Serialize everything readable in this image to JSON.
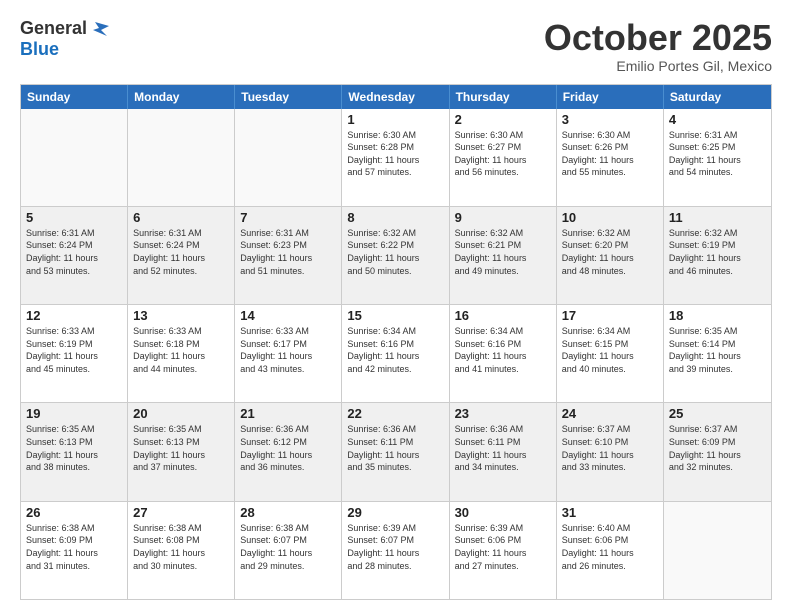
{
  "header": {
    "logo_general": "General",
    "logo_blue": "Blue",
    "month_title": "October 2025",
    "subtitle": "Emilio Portes Gil, Mexico"
  },
  "weekdays": [
    "Sunday",
    "Monday",
    "Tuesday",
    "Wednesday",
    "Thursday",
    "Friday",
    "Saturday"
  ],
  "weeks": [
    [
      {
        "day": "",
        "info": "",
        "empty": true
      },
      {
        "day": "",
        "info": "",
        "empty": true
      },
      {
        "day": "",
        "info": "",
        "empty": true
      },
      {
        "day": "1",
        "info": "Sunrise: 6:30 AM\nSunset: 6:28 PM\nDaylight: 11 hours\nand 57 minutes."
      },
      {
        "day": "2",
        "info": "Sunrise: 6:30 AM\nSunset: 6:27 PM\nDaylight: 11 hours\nand 56 minutes."
      },
      {
        "day": "3",
        "info": "Sunrise: 6:30 AM\nSunset: 6:26 PM\nDaylight: 11 hours\nand 55 minutes."
      },
      {
        "day": "4",
        "info": "Sunrise: 6:31 AM\nSunset: 6:25 PM\nDaylight: 11 hours\nand 54 minutes."
      }
    ],
    [
      {
        "day": "5",
        "info": "Sunrise: 6:31 AM\nSunset: 6:24 PM\nDaylight: 11 hours\nand 53 minutes."
      },
      {
        "day": "6",
        "info": "Sunrise: 6:31 AM\nSunset: 6:24 PM\nDaylight: 11 hours\nand 52 minutes."
      },
      {
        "day": "7",
        "info": "Sunrise: 6:31 AM\nSunset: 6:23 PM\nDaylight: 11 hours\nand 51 minutes."
      },
      {
        "day": "8",
        "info": "Sunrise: 6:32 AM\nSunset: 6:22 PM\nDaylight: 11 hours\nand 50 minutes."
      },
      {
        "day": "9",
        "info": "Sunrise: 6:32 AM\nSunset: 6:21 PM\nDaylight: 11 hours\nand 49 minutes."
      },
      {
        "day": "10",
        "info": "Sunrise: 6:32 AM\nSunset: 6:20 PM\nDaylight: 11 hours\nand 48 minutes."
      },
      {
        "day": "11",
        "info": "Sunrise: 6:32 AM\nSunset: 6:19 PM\nDaylight: 11 hours\nand 46 minutes."
      }
    ],
    [
      {
        "day": "12",
        "info": "Sunrise: 6:33 AM\nSunset: 6:19 PM\nDaylight: 11 hours\nand 45 minutes."
      },
      {
        "day": "13",
        "info": "Sunrise: 6:33 AM\nSunset: 6:18 PM\nDaylight: 11 hours\nand 44 minutes."
      },
      {
        "day": "14",
        "info": "Sunrise: 6:33 AM\nSunset: 6:17 PM\nDaylight: 11 hours\nand 43 minutes."
      },
      {
        "day": "15",
        "info": "Sunrise: 6:34 AM\nSunset: 6:16 PM\nDaylight: 11 hours\nand 42 minutes."
      },
      {
        "day": "16",
        "info": "Sunrise: 6:34 AM\nSunset: 6:16 PM\nDaylight: 11 hours\nand 41 minutes."
      },
      {
        "day": "17",
        "info": "Sunrise: 6:34 AM\nSunset: 6:15 PM\nDaylight: 11 hours\nand 40 minutes."
      },
      {
        "day": "18",
        "info": "Sunrise: 6:35 AM\nSunset: 6:14 PM\nDaylight: 11 hours\nand 39 minutes."
      }
    ],
    [
      {
        "day": "19",
        "info": "Sunrise: 6:35 AM\nSunset: 6:13 PM\nDaylight: 11 hours\nand 38 minutes."
      },
      {
        "day": "20",
        "info": "Sunrise: 6:35 AM\nSunset: 6:13 PM\nDaylight: 11 hours\nand 37 minutes."
      },
      {
        "day": "21",
        "info": "Sunrise: 6:36 AM\nSunset: 6:12 PM\nDaylight: 11 hours\nand 36 minutes."
      },
      {
        "day": "22",
        "info": "Sunrise: 6:36 AM\nSunset: 6:11 PM\nDaylight: 11 hours\nand 35 minutes."
      },
      {
        "day": "23",
        "info": "Sunrise: 6:36 AM\nSunset: 6:11 PM\nDaylight: 11 hours\nand 34 minutes."
      },
      {
        "day": "24",
        "info": "Sunrise: 6:37 AM\nSunset: 6:10 PM\nDaylight: 11 hours\nand 33 minutes."
      },
      {
        "day": "25",
        "info": "Sunrise: 6:37 AM\nSunset: 6:09 PM\nDaylight: 11 hours\nand 32 minutes."
      }
    ],
    [
      {
        "day": "26",
        "info": "Sunrise: 6:38 AM\nSunset: 6:09 PM\nDaylight: 11 hours\nand 31 minutes."
      },
      {
        "day": "27",
        "info": "Sunrise: 6:38 AM\nSunset: 6:08 PM\nDaylight: 11 hours\nand 30 minutes."
      },
      {
        "day": "28",
        "info": "Sunrise: 6:38 AM\nSunset: 6:07 PM\nDaylight: 11 hours\nand 29 minutes."
      },
      {
        "day": "29",
        "info": "Sunrise: 6:39 AM\nSunset: 6:07 PM\nDaylight: 11 hours\nand 28 minutes."
      },
      {
        "day": "30",
        "info": "Sunrise: 6:39 AM\nSunset: 6:06 PM\nDaylight: 11 hours\nand 27 minutes."
      },
      {
        "day": "31",
        "info": "Sunrise: 6:40 AM\nSunset: 6:06 PM\nDaylight: 11 hours\nand 26 minutes."
      },
      {
        "day": "",
        "info": "",
        "empty": true
      }
    ]
  ]
}
